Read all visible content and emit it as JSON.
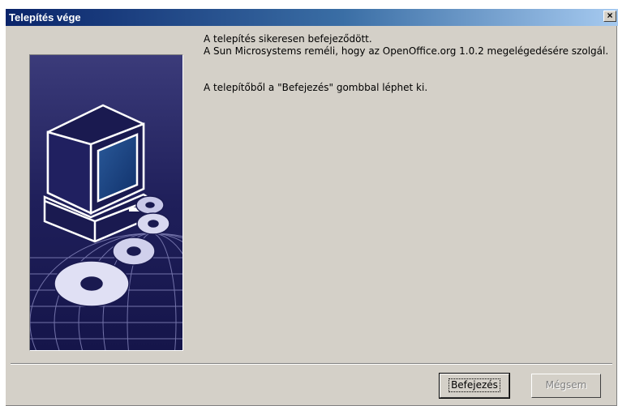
{
  "window": {
    "title": "Telepítés vége"
  },
  "message": {
    "line1": "A telepítés sikeresen befejeződött.",
    "line2": "A Sun Microsystems reméli, hogy az OpenOffice.org 1.0.2 megelégedésére szolgál.",
    "line3": "A telepítőből a \"Befejezés\" gombbal léphet ki."
  },
  "buttons": {
    "finish": "Befejezés",
    "cancel": "Mégsem"
  },
  "icons": {
    "close": "close-icon",
    "illustration": "computer-discs-globe-illustration"
  },
  "colors": {
    "titlebar_start": "#0a246a",
    "titlebar_end": "#a6caf0",
    "dialog_bg": "#d4d0c8",
    "art_bg": "#23235a"
  }
}
